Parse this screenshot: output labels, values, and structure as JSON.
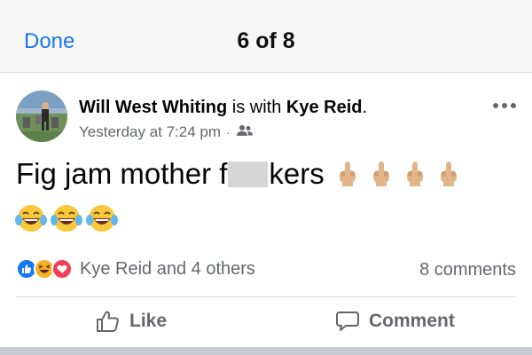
{
  "header": {
    "done_label": "Done",
    "counter": "6 of 8"
  },
  "post": {
    "author": "Will West Whiting",
    "with_text": " is with ",
    "tagged": "Kye Reid",
    "period": ".",
    "timestamp": "Yesterday at 7:24 pm",
    "separator": "·",
    "audience_icon": "friends-icon",
    "text_before": "Fig jam mother f",
    "text_after": "kers",
    "emoji_fingers": "middle-finger-emoji",
    "emoji_laugh": "tears-of-joy-emoji"
  },
  "engagement": {
    "reaction_summary": "Kye Reid and 4 others",
    "comments": "8 comments",
    "reaction_icons": [
      "like-reaction-icon",
      "haha-reaction-icon",
      "love-reaction-icon"
    ]
  },
  "actions": {
    "like_label": "Like",
    "comment_label": "Comment"
  },
  "colors": {
    "accent": "#1877f2",
    "secondary_text": "#65676b",
    "love": "#f33e58",
    "haha": "#f7b125"
  }
}
